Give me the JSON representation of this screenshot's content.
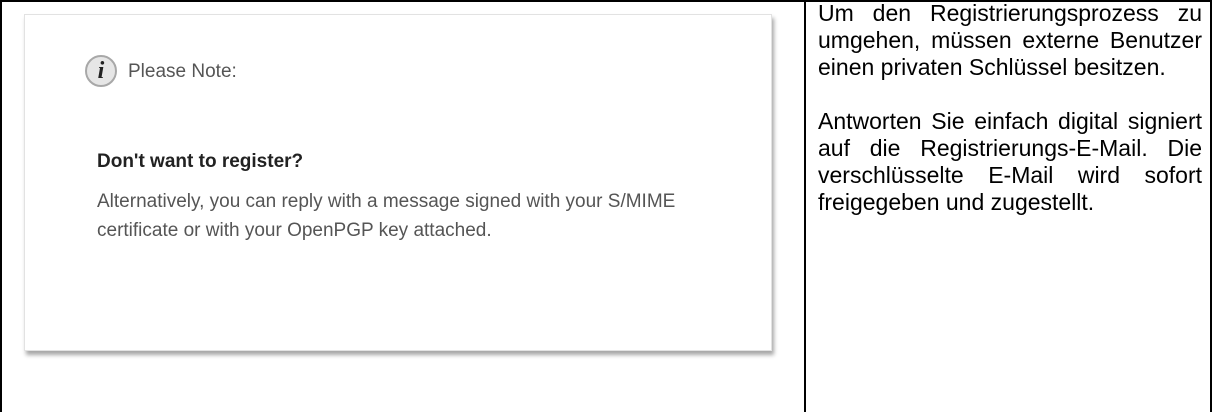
{
  "left_card": {
    "note_title": "Please Note:",
    "heading": "Don't want to register?",
    "body": "Alternatively, you can reply with a message signed with your S/MIME certificate or with your OpenPGP key attached.",
    "icon": "info-icon"
  },
  "right_cell": {
    "paragraph1": "Um den Registrierungsprozess zu umgehen, müssen externe Benutzer einen privaten Schlüssel besitzen.",
    "paragraph2": "Antworten Sie einfach digital signiert auf die Registrierungs-E-Mail. Die verschlüsselte E-Mail wird sofort freigegeben und zugestellt."
  }
}
